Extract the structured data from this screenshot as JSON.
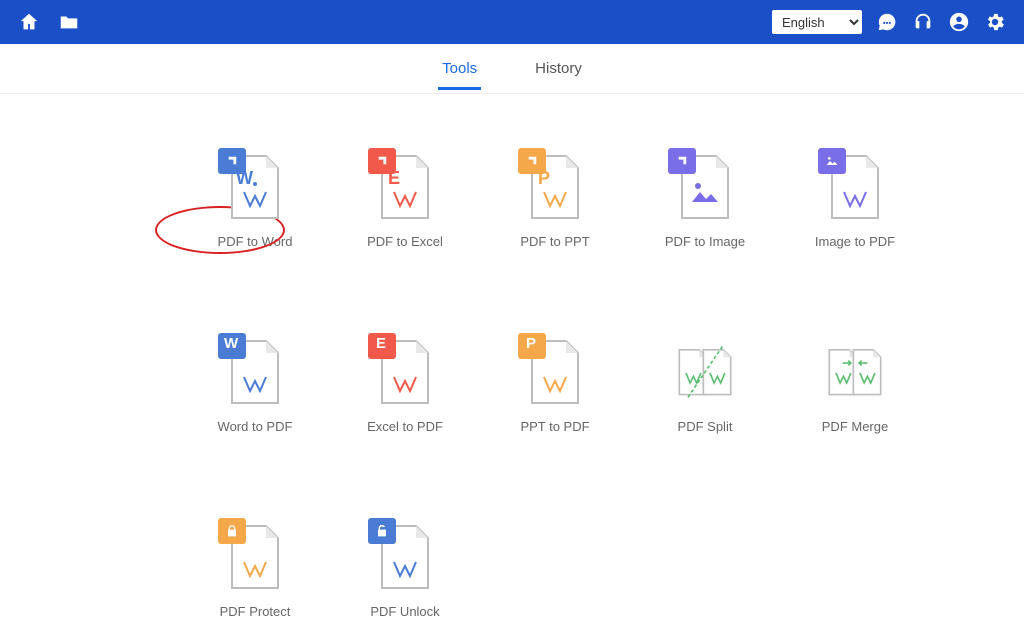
{
  "header": {
    "language_selected": "English"
  },
  "tabs": {
    "tools": "Tools",
    "history": "History",
    "active": "tools"
  },
  "tools": {
    "pdf_to_word": {
      "label": "PDF to Word"
    },
    "pdf_to_excel": {
      "label": "PDF to Excel"
    },
    "pdf_to_ppt": {
      "label": "PDF to PPT"
    },
    "pdf_to_image": {
      "label": "PDF to Image"
    },
    "image_to_pdf": {
      "label": "Image to PDF"
    },
    "word_to_pdf": {
      "label": "Word to PDF"
    },
    "excel_to_pdf": {
      "label": "Excel to PDF"
    },
    "ppt_to_pdf": {
      "label": "PPT to PDF"
    },
    "pdf_split": {
      "label": "PDF Split"
    },
    "pdf_merge": {
      "label": "PDF Merge"
    },
    "pdf_protect": {
      "label": "PDF Protect"
    },
    "pdf_unlock": {
      "label": "PDF Unlock"
    }
  },
  "colors": {
    "word": "#4a7cd6",
    "excel": "#f15a4a",
    "ppt": "#f5a84a",
    "image": "#7a6ee8",
    "lock": "#f5a84a",
    "unlock": "#4a7cd6",
    "split": "#5cbf70",
    "merge": "#5cbf70",
    "pdf_stroke": "#bdbdbd",
    "brand": "#1a4fc7"
  },
  "annotation": {
    "highlighted_tool": "pdf_to_word"
  }
}
